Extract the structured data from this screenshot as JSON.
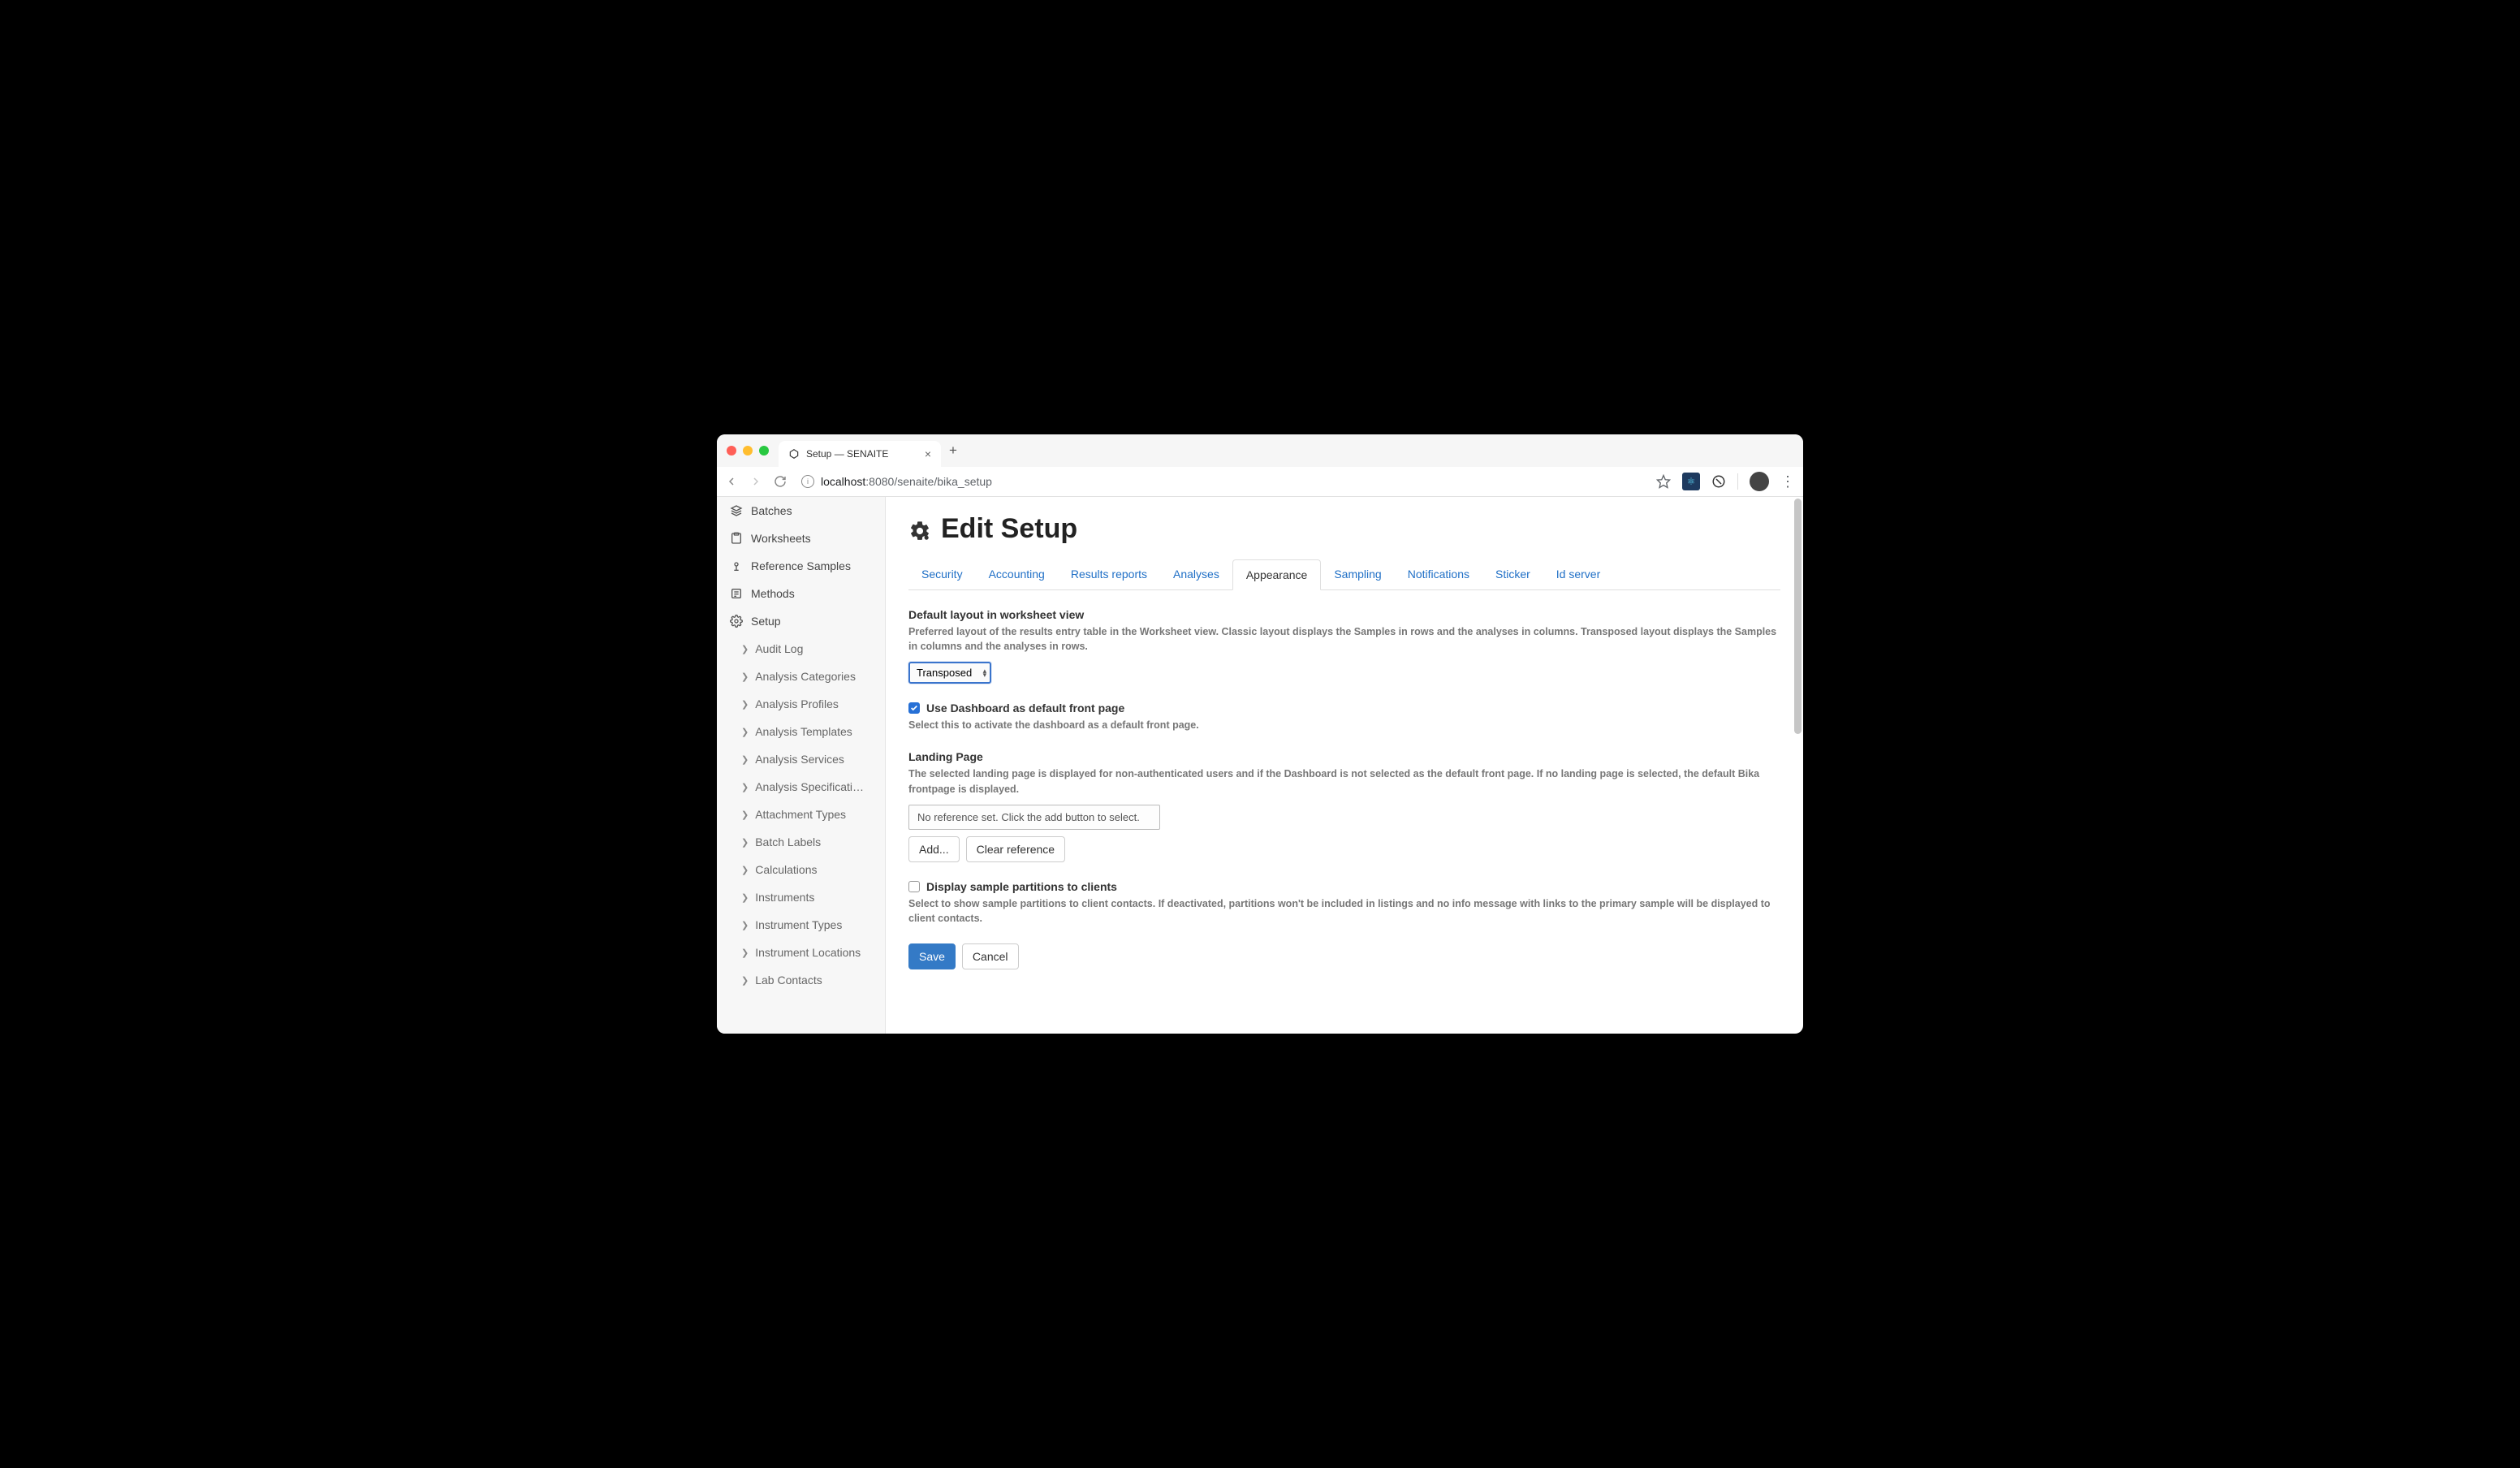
{
  "browser": {
    "tab_title": "Setup — SENAITE",
    "url_host": "localhost",
    "url_port": ":8080",
    "url_path": "/senaite/bika_setup"
  },
  "sidebar": {
    "items": [
      {
        "label": "Batches"
      },
      {
        "label": "Worksheets"
      },
      {
        "label": "Reference Samples"
      },
      {
        "label": "Methods"
      },
      {
        "label": "Setup"
      }
    ],
    "subitems": [
      {
        "label": "Audit Log"
      },
      {
        "label": "Analysis Categories"
      },
      {
        "label": "Analysis Profiles"
      },
      {
        "label": "Analysis Templates"
      },
      {
        "label": "Analysis Services"
      },
      {
        "label": "Analysis Specificati…"
      },
      {
        "label": "Attachment Types"
      },
      {
        "label": "Batch Labels"
      },
      {
        "label": "Calculations"
      },
      {
        "label": "Instruments"
      },
      {
        "label": "Instrument Types"
      },
      {
        "label": "Instrument Locations"
      },
      {
        "label": "Lab Contacts"
      }
    ]
  },
  "page": {
    "title": "Edit Setup"
  },
  "tabs": [
    {
      "label": "Security"
    },
    {
      "label": "Accounting"
    },
    {
      "label": "Results reports"
    },
    {
      "label": "Analyses"
    },
    {
      "label": "Appearance",
      "active": true
    },
    {
      "label": "Sampling"
    },
    {
      "label": "Notifications"
    },
    {
      "label": "Sticker"
    },
    {
      "label": "Id server"
    }
  ],
  "form": {
    "default_layout": {
      "label": "Default layout in worksheet view",
      "help": "Preferred layout of the results entry table in the Worksheet view. Classic layout displays the Samples in rows and the analyses in columns. Transposed layout displays the Samples in columns and the analyses in rows.",
      "value": "Transposed"
    },
    "dashboard": {
      "label": "Use Dashboard as default front page",
      "help": "Select this to activate the dashboard as a default front page.",
      "checked": true
    },
    "landing": {
      "label": "Landing Page",
      "help": "The selected landing page is displayed for non-authenticated users and if the Dashboard is not selected as the default front page. If no landing page is selected, the default Bika frontpage is displayed.",
      "placeholder": "No reference set. Click the add button to select.",
      "add": "Add...",
      "clear": "Clear reference"
    },
    "partitions": {
      "label": "Display sample partitions to clients",
      "help": "Select to show sample partitions to client contacts. If deactivated, partitions won't be included in listings and no info message with links to the primary sample will be displayed to client contacts.",
      "checked": false
    },
    "save": "Save",
    "cancel": "Cancel"
  }
}
